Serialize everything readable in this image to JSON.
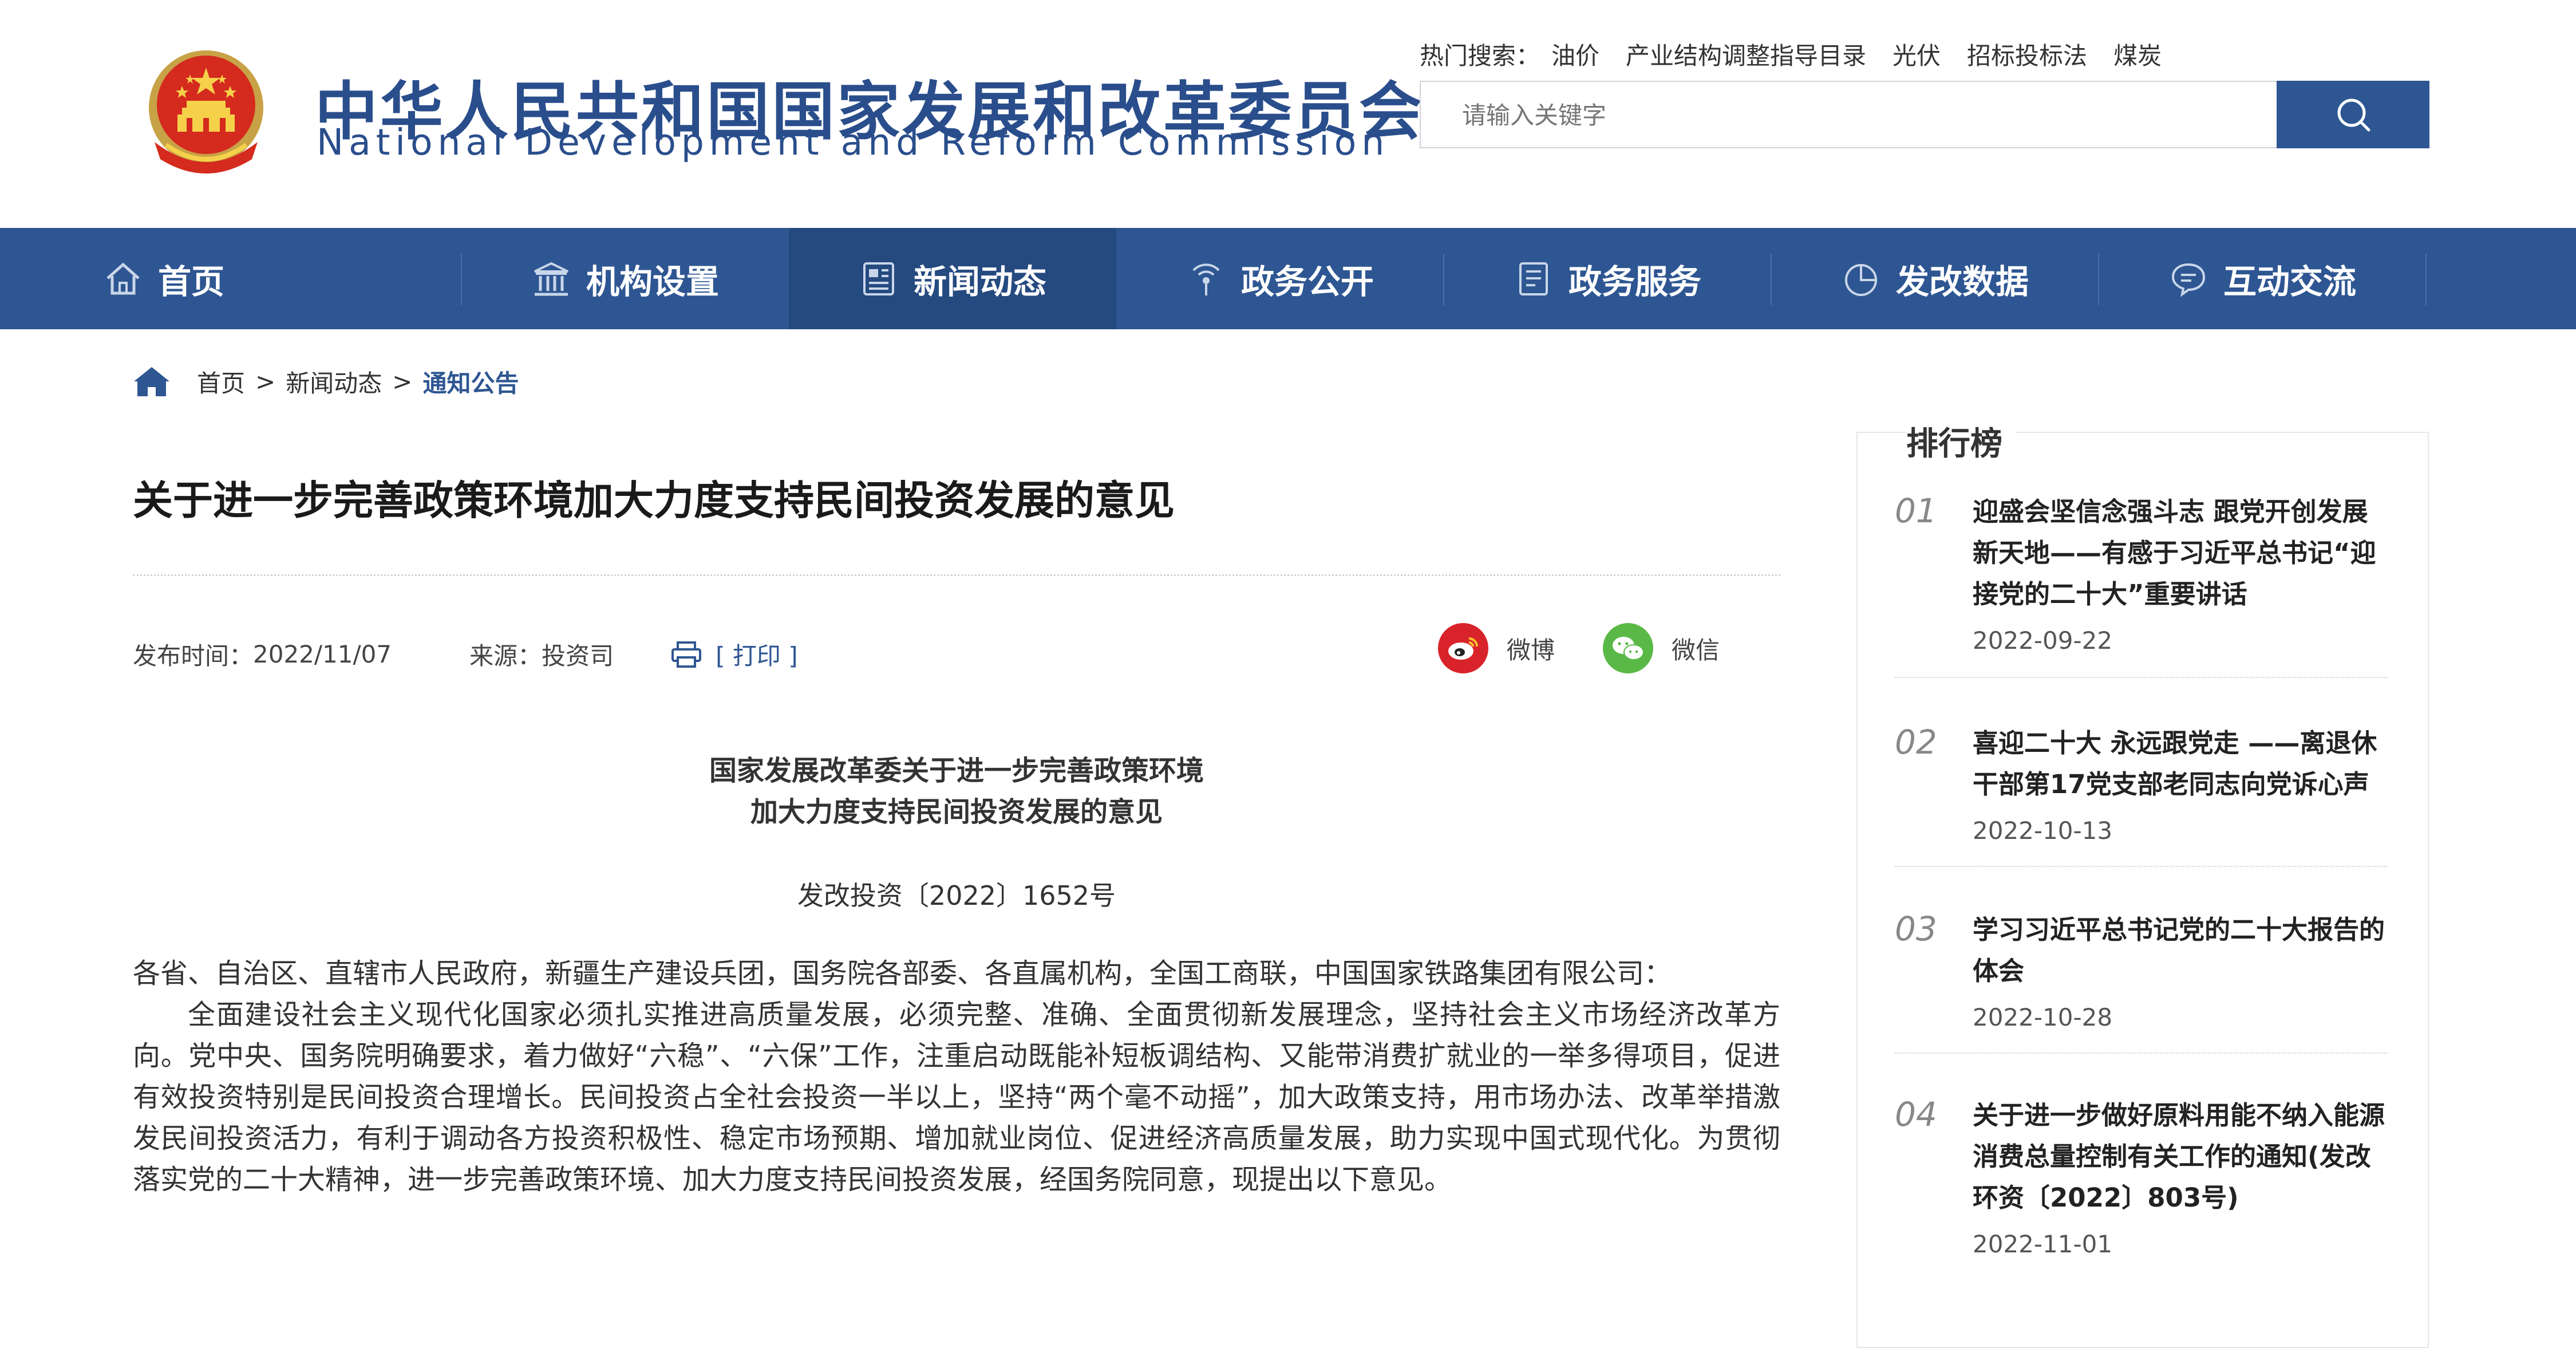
{
  "header": {
    "title_cn": "中华人民共和国国家发展和改革委员会",
    "title_en": "National Development and Reform Commission",
    "hot_label": "热门搜索：",
    "hot_items": [
      "油价",
      "产业结构调整指导目录",
      "光伏",
      "招标投标法",
      "煤炭"
    ],
    "search_placeholder": "请输入关键字"
  },
  "nav": {
    "items": [
      {
        "label": "首页",
        "icon": "home-icon"
      },
      {
        "label": "机构设置",
        "icon": "building-icon"
      },
      {
        "label": "新闻动态",
        "icon": "news-icon"
      },
      {
        "label": "政务公开",
        "icon": "broadcast-icon"
      },
      {
        "label": "政务服务",
        "icon": "document-icon"
      },
      {
        "label": "发改数据",
        "icon": "pie-chart-icon"
      },
      {
        "label": "互动交流",
        "icon": "chat-icon"
      }
    ],
    "active_index": 2
  },
  "breadcrumb": {
    "home": "首页",
    "sep": ">",
    "section": "新闻动态",
    "current": "通知公告"
  },
  "article": {
    "title": "关于进一步完善政策环境加大力度支持民间投资发展的意见",
    "date_label": "发布时间：",
    "date": "2022/11/07",
    "source_label": "来源：",
    "source": "投资司",
    "print_label": "[ 打印 ]",
    "share_weibo": "微博",
    "share_wechat": "微信",
    "doc_heading_line1": "国家发展改革委关于进一步完善政策环境",
    "doc_heading_line2": "加大力度支持民间投资发展的意见",
    "doc_number": "发改投资〔2022〕1652号",
    "addressee": "各省、自治区、直辖市人民政府，新疆生产建设兵团，国务院各部委、各直属机构，全国工商联，中国国家铁路集团有限公司：",
    "paragraph1": "全面建设社会主义现代化国家必须扎实推进高质量发展，必须完整、准确、全面贯彻新发展理念，坚持社会主义市场经济改革方向。党中央、国务院明确要求，着力做好“六稳”、“六保”工作，注重启动既能补短板调结构、又能带消费扩就业的一举多得项目，促进有效投资特别是民间投资合理增长。民间投资占全社会投资一半以上，坚持“两个毫不动摇”，加大政策支持，用市场办法、改革举措激发民间投资活力，有利于调动各方投资积极性、稳定市场预期、增加就业岗位、促进经济高质量发展，助力实现中国式现代化。为贯彻落实党的二十大精神，进一步完善政策环境、加大力度支持民间投资发展，经国务院同意，现提出以下意见。"
  },
  "sidebar": {
    "title": "排行榜",
    "items": [
      {
        "num": "01",
        "title": "迎盛会坚信念强斗志 跟党开创发展新天地——有感于习近平总书记“迎接党的二十大”重要讲话",
        "date": "2022-09-22"
      },
      {
        "num": "02",
        "title": "喜迎二十大 永远跟党走 ——离退休干部第17党支部老同志向党诉心声",
        "date": "2022-10-13"
      },
      {
        "num": "03",
        "title": "学习习近平总书记党的二十大报告的体会",
        "date": "2022-10-28"
      },
      {
        "num": "04",
        "title": "关于进一步做好原料用能不纳入能源消费总量控制有关工作的通知(发改环资〔2022〕803号)",
        "date": "2022-11-01"
      }
    ]
  },
  "colors": {
    "brand_blue": "#2e5692",
    "nav_active": "#254a80",
    "weibo_red": "#d9232a",
    "wechat_green": "#5ab946"
  }
}
